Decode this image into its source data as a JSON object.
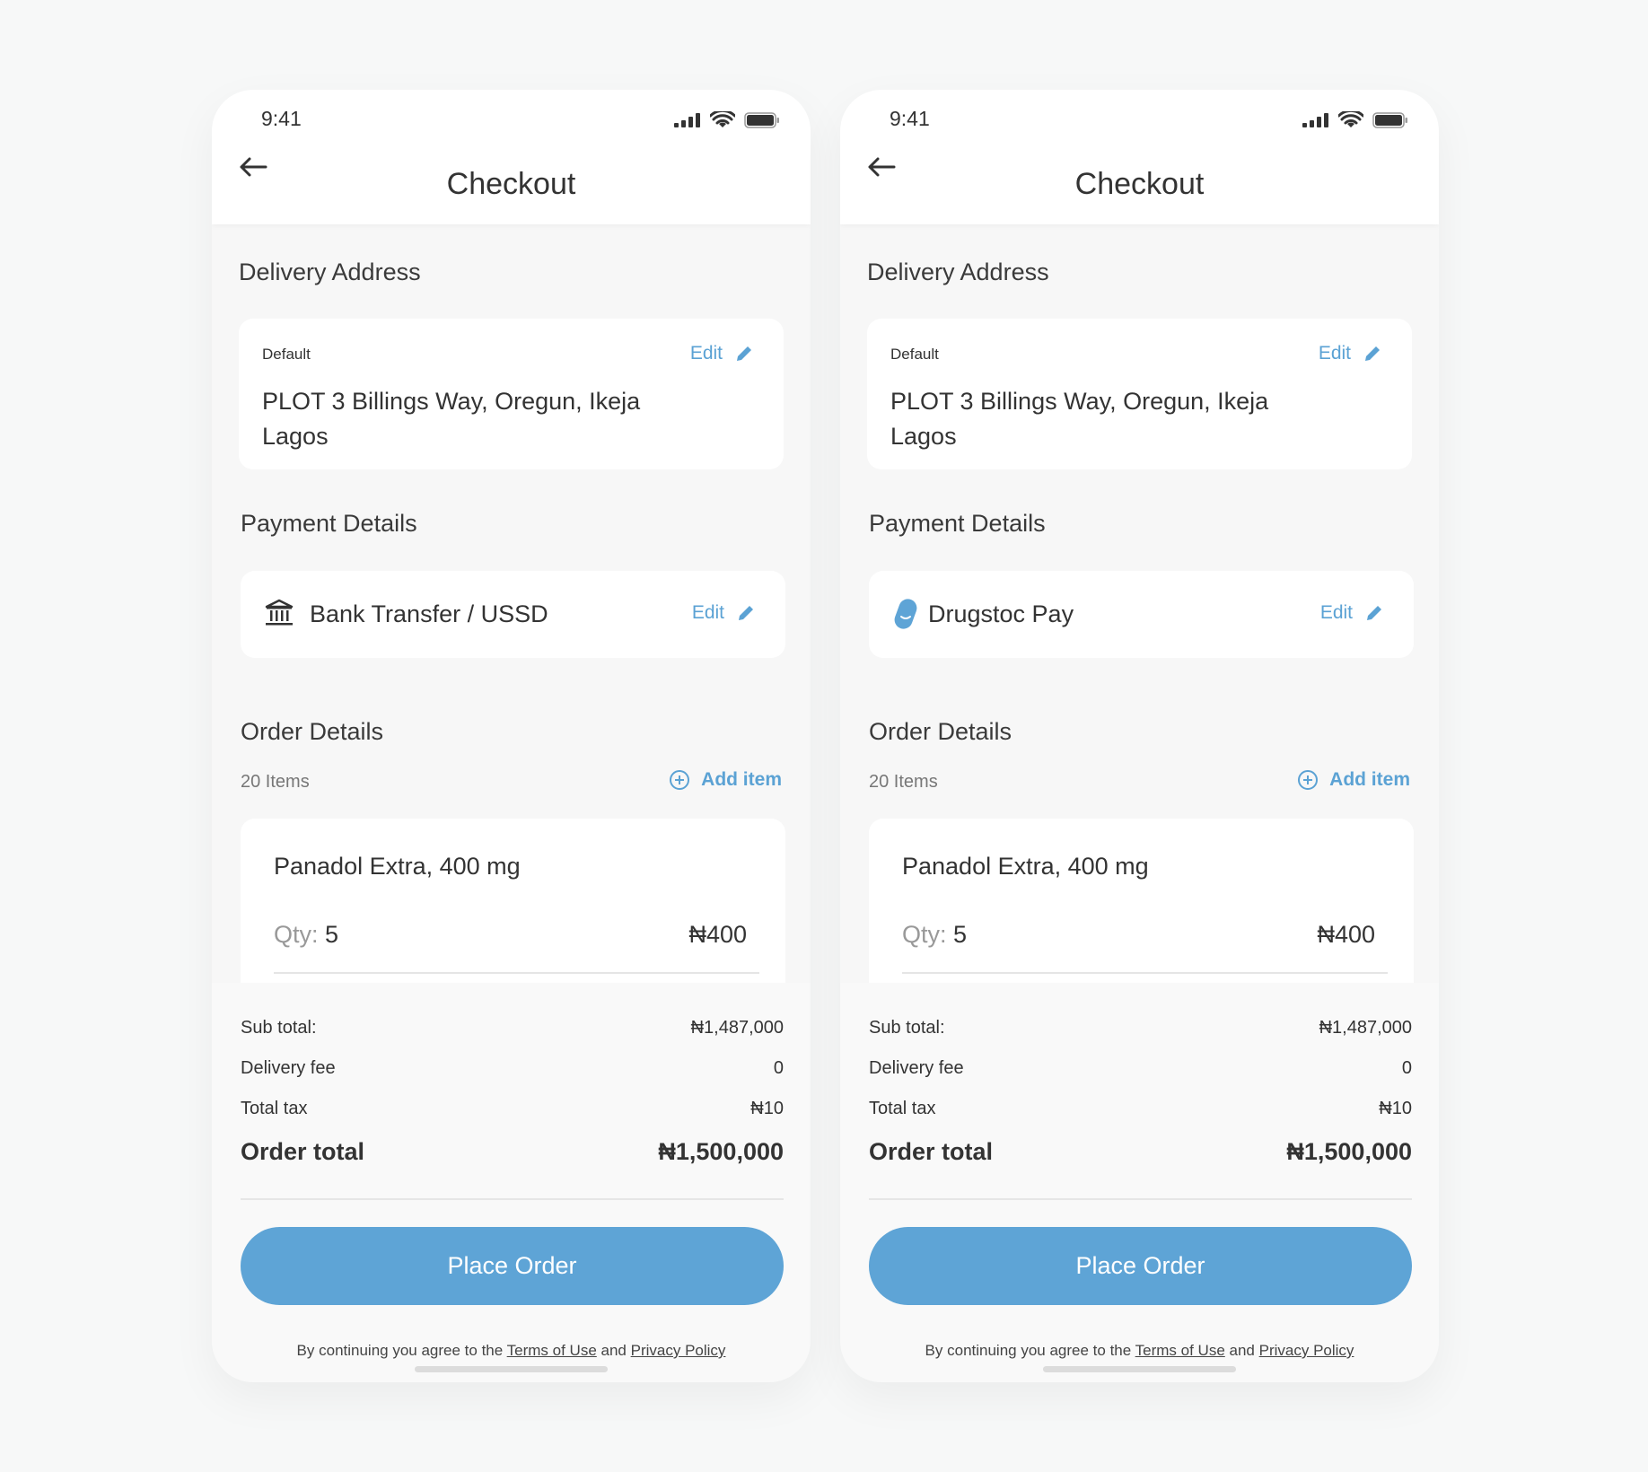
{
  "screens": [
    {
      "status_bar": {
        "time": "9:41"
      },
      "header": {
        "title": "Checkout"
      },
      "delivery": {
        "section_title": "Delivery Address",
        "tag": "Default",
        "edit_label": "Edit",
        "address_line1": "PLOT 3 Billings Way, Oregun, Ikeja",
        "address_line2": "Lagos"
      },
      "payment": {
        "section_title": "Payment Details",
        "method": "Bank Transfer / USSD",
        "method_icon": "bank-icon",
        "edit_label": "Edit"
      },
      "order": {
        "section_title": "Order Details",
        "items_count": "20 Items",
        "add_item_label": "Add item",
        "item": {
          "name": "Panadol Extra, 400 mg",
          "qty_label": "Qty:",
          "qty": "5",
          "price": "₦400"
        }
      },
      "summary": {
        "subtotal_label": "Sub total:",
        "subtotal": "₦1,487,000",
        "delivery_label": "Delivery fee",
        "delivery": "0",
        "tax_label": "Total tax",
        "tax": "₦10",
        "total_label": "Order total",
        "total": "₦1,500,000",
        "place_order": "Place Order",
        "terms_prefix": "By continuing you agree to the",
        "terms_link": "Terms of Use",
        "terms_and": "and",
        "privacy_link": "Privacy Policy"
      }
    },
    {
      "status_bar": {
        "time": "9:41"
      },
      "header": {
        "title": "Checkout"
      },
      "delivery": {
        "section_title": "Delivery Address",
        "tag": "Default",
        "edit_label": "Edit",
        "address_line1": "PLOT 3 Billings Way, Oregun, Ikeja",
        "address_line2": "Lagos"
      },
      "payment": {
        "section_title": "Payment Details",
        "method": "Drugstoc Pay",
        "method_icon": "drugstoc-pill-icon",
        "edit_label": "Edit"
      },
      "order": {
        "section_title": "Order Details",
        "items_count": "20 Items",
        "add_item_label": "Add item",
        "item": {
          "name": "Panadol Extra, 400 mg",
          "qty_label": "Qty:",
          "qty": "5",
          "price": "₦400"
        }
      },
      "summary": {
        "subtotal_label": "Sub total:",
        "subtotal": "₦1,487,000",
        "delivery_label": "Delivery fee",
        "delivery": "0",
        "tax_label": "Total tax",
        "tax": "₦10",
        "total_label": "Order total",
        "total": "₦1,500,000",
        "place_order": "Place Order",
        "terms_prefix": "By continuing you agree to the",
        "terms_link": "Terms of Use",
        "terms_and": "and",
        "privacy_link": "Privacy Policy"
      }
    }
  ],
  "colors": {
    "accent": "#5ea4d6",
    "link": "#5ba2d4",
    "background": "#f7f8f8",
    "card": "#ffffff"
  }
}
